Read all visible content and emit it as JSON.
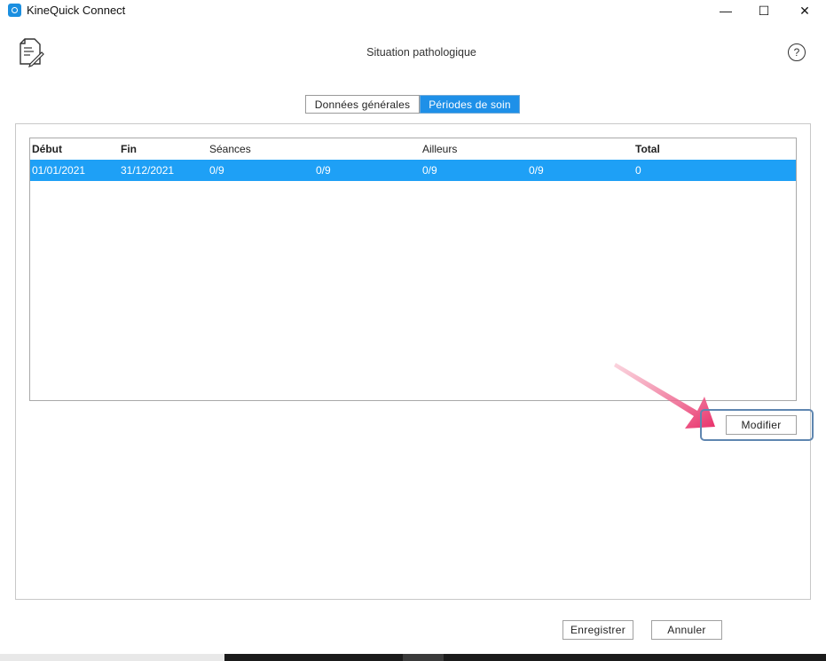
{
  "window": {
    "title": "KineQuick Connect",
    "minimize_glyph": "—",
    "maximize_glyph": "☐",
    "close_glyph": "✕"
  },
  "header": {
    "title": "Situation pathologique",
    "help_glyph": "?"
  },
  "tabs": [
    {
      "label": "Données générales",
      "active": false
    },
    {
      "label": "Périodes de soin",
      "active": true
    }
  ],
  "table": {
    "columns": [
      "Début",
      "Fin",
      "Séances",
      "Ailleurs",
      "Total"
    ],
    "rows": [
      {
        "debut": "01/01/2021",
        "fin": "31/12/2021",
        "seances_1": "0/9",
        "seances_2": "0/9",
        "ailleurs_1": "0/9",
        "ailleurs_2": "0/9",
        "total": "0",
        "selected": true
      }
    ]
  },
  "buttons": {
    "modifier": "Modifier",
    "enregistrer": "Enregistrer",
    "annuler": "Annuler"
  },
  "icons": {
    "app": "kinequick-app-icon",
    "document": "document-edit-icon",
    "help": "help-circle-icon",
    "annotation": "pointer-arrow-icon"
  },
  "colors": {
    "accent": "#1e90e8",
    "selection": "#1ea0f6",
    "annotation_arrow": "#e8306a",
    "highlight_border": "#5f86b0"
  }
}
